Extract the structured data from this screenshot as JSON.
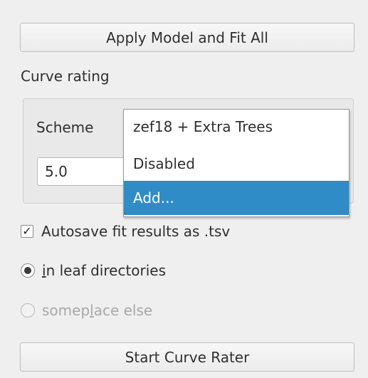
{
  "buttons": {
    "apply": "Apply Model and Fit All",
    "start_rater": "Start Curve Rater"
  },
  "curve_rating": {
    "title": "Curve rating",
    "scheme_label": "Scheme",
    "value": "5.0",
    "dropdown": {
      "items": [
        "zef18 + Extra Trees",
        "Disabled",
        "Add..."
      ],
      "selected_index": 2
    }
  },
  "autosave": {
    "checked": true,
    "check_glyph": "✓",
    "label": "Autosave fit results as .tsv"
  },
  "location": {
    "option1": {
      "pre": "",
      "mnemonic": "i",
      "post": "n leaf directories",
      "selected": true,
      "enabled": true
    },
    "option2": {
      "pre": "somep",
      "mnemonic": "l",
      "post": "ace else",
      "selected": false,
      "enabled": false
    }
  },
  "colors": {
    "selection": "#308cc6",
    "background": "#efefef",
    "disabled_text": "#a8a8a8"
  }
}
